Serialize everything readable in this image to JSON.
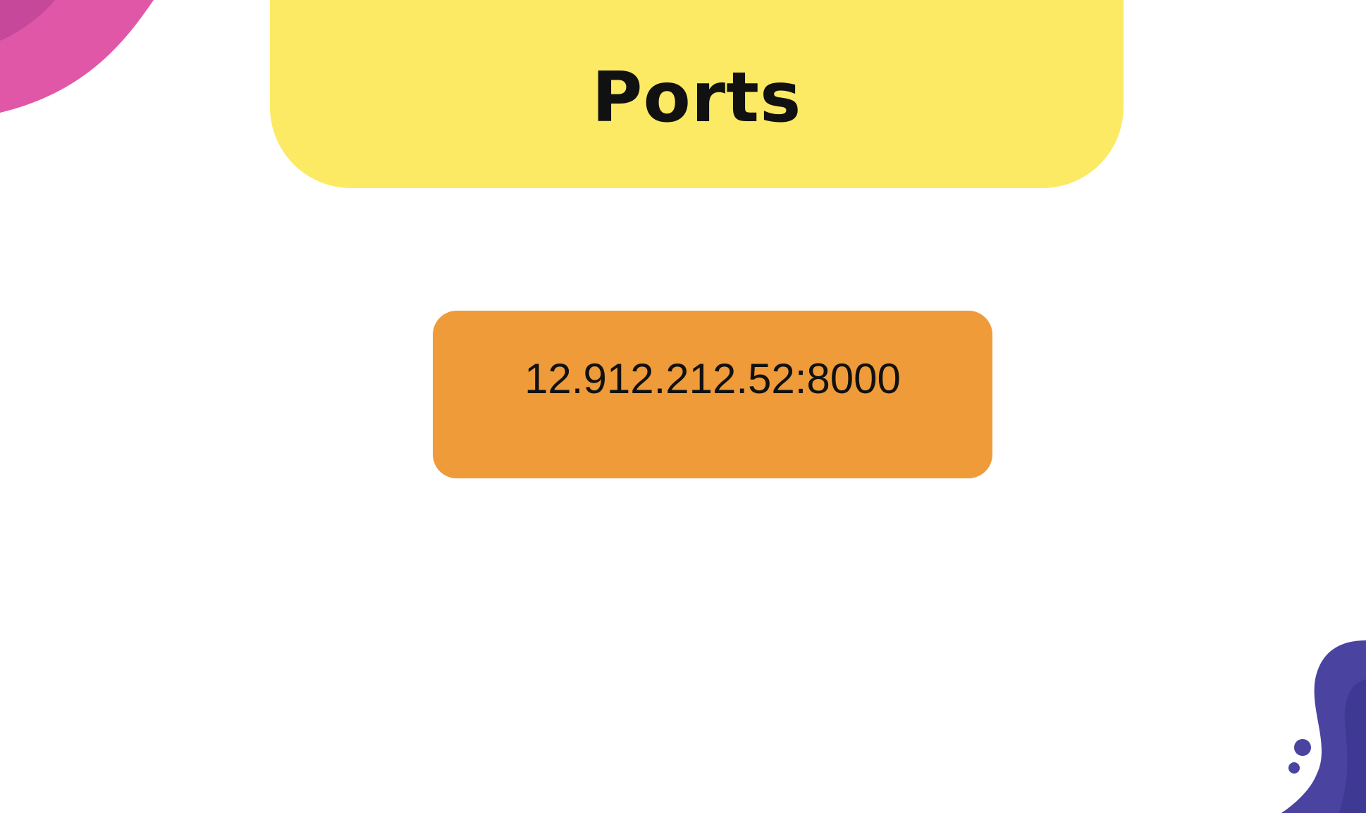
{
  "slide": {
    "title": "Ports",
    "address": "12.912.212.52:8000"
  },
  "colors": {
    "title_card": "#fcea64",
    "address_box": "#ef9b3a",
    "pink_blob": "#df57a6",
    "pink_blob_inner": "#c6489a",
    "purple_blob": "#4a43a0",
    "purple_blob_inner": "#3e3993"
  }
}
